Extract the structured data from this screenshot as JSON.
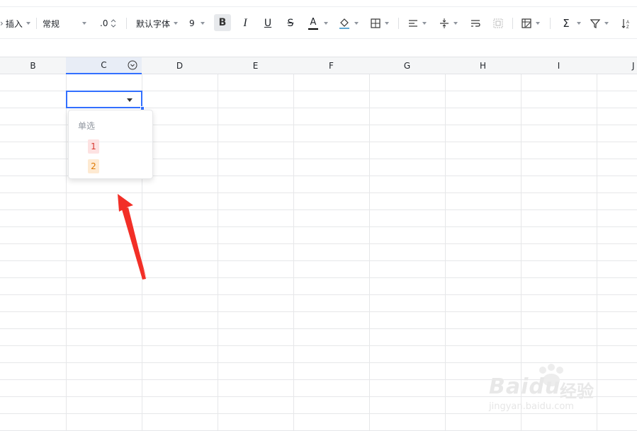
{
  "toolbar": {
    "insert_label": "插入",
    "format_label": "常规",
    "decimal_label": ".0",
    "font_label": "默认字体",
    "size_label": "9",
    "bold_label": "B",
    "italic_label": "I",
    "underline_label": "U",
    "strike_label": "S",
    "font_color_letter": "A",
    "accent_color": "#3370ff",
    "font_color": "#000000",
    "fill_color": "#5fa8d3"
  },
  "columns": [
    {
      "label": "B"
    },
    {
      "label": "C"
    },
    {
      "label": "D"
    },
    {
      "label": "E"
    },
    {
      "label": "F"
    },
    {
      "label": "G"
    },
    {
      "label": "H"
    },
    {
      "label": "I"
    },
    {
      "label": "J"
    }
  ],
  "dropdown": {
    "title": "单选",
    "options": [
      {
        "label": "1",
        "color": "#d83931"
      },
      {
        "label": "2",
        "color": "#de7802"
      }
    ]
  },
  "watermark": {
    "brand": "Bai",
    "brand2": "du",
    "cn": "经验",
    "url": "jingyan.baidu.com"
  }
}
